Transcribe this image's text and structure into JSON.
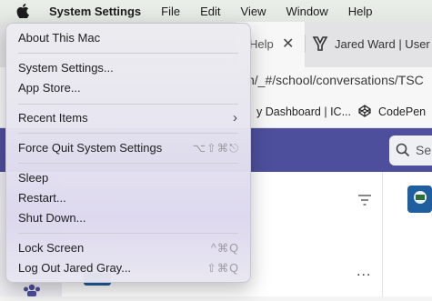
{
  "menubar": {
    "app_name": "System Settings",
    "items": [
      "File",
      "Edit",
      "View",
      "Window",
      "Help"
    ]
  },
  "browser": {
    "active_tab_label": "Help",
    "tab_close": "✕",
    "second_tab_label": "Jared Ward | User |",
    "url": "n/_#/school/conversations/TSC",
    "bookmarks": [
      "y Dashboard | IC...",
      "CodePen"
    ],
    "search_placeholder": "Se"
  },
  "apple_menu": {
    "items": [
      {
        "label": "About This Mac"
      },
      {
        "label": "System Settings..."
      },
      {
        "label": "App Store..."
      },
      {
        "label": "Recent Items",
        "submenu": true
      },
      {
        "label": "Force Quit System Settings",
        "shortcut": "⌥⇧⌘⎋"
      },
      {
        "label": "Sleep"
      },
      {
        "label": "Restart..."
      },
      {
        "label": "Shut Down..."
      },
      {
        "label": "Lock Screen",
        "shortcut": "^⌘Q"
      },
      {
        "label": "Log Out Jared Gray...",
        "shortcut": "⇧⌘Q"
      }
    ]
  },
  "content": {
    "more_label": "..."
  },
  "colors": {
    "header_purple": "#4d4f9d",
    "menu_bg": "#ebe9f0",
    "avatar_blue": "#1f5fa0"
  }
}
